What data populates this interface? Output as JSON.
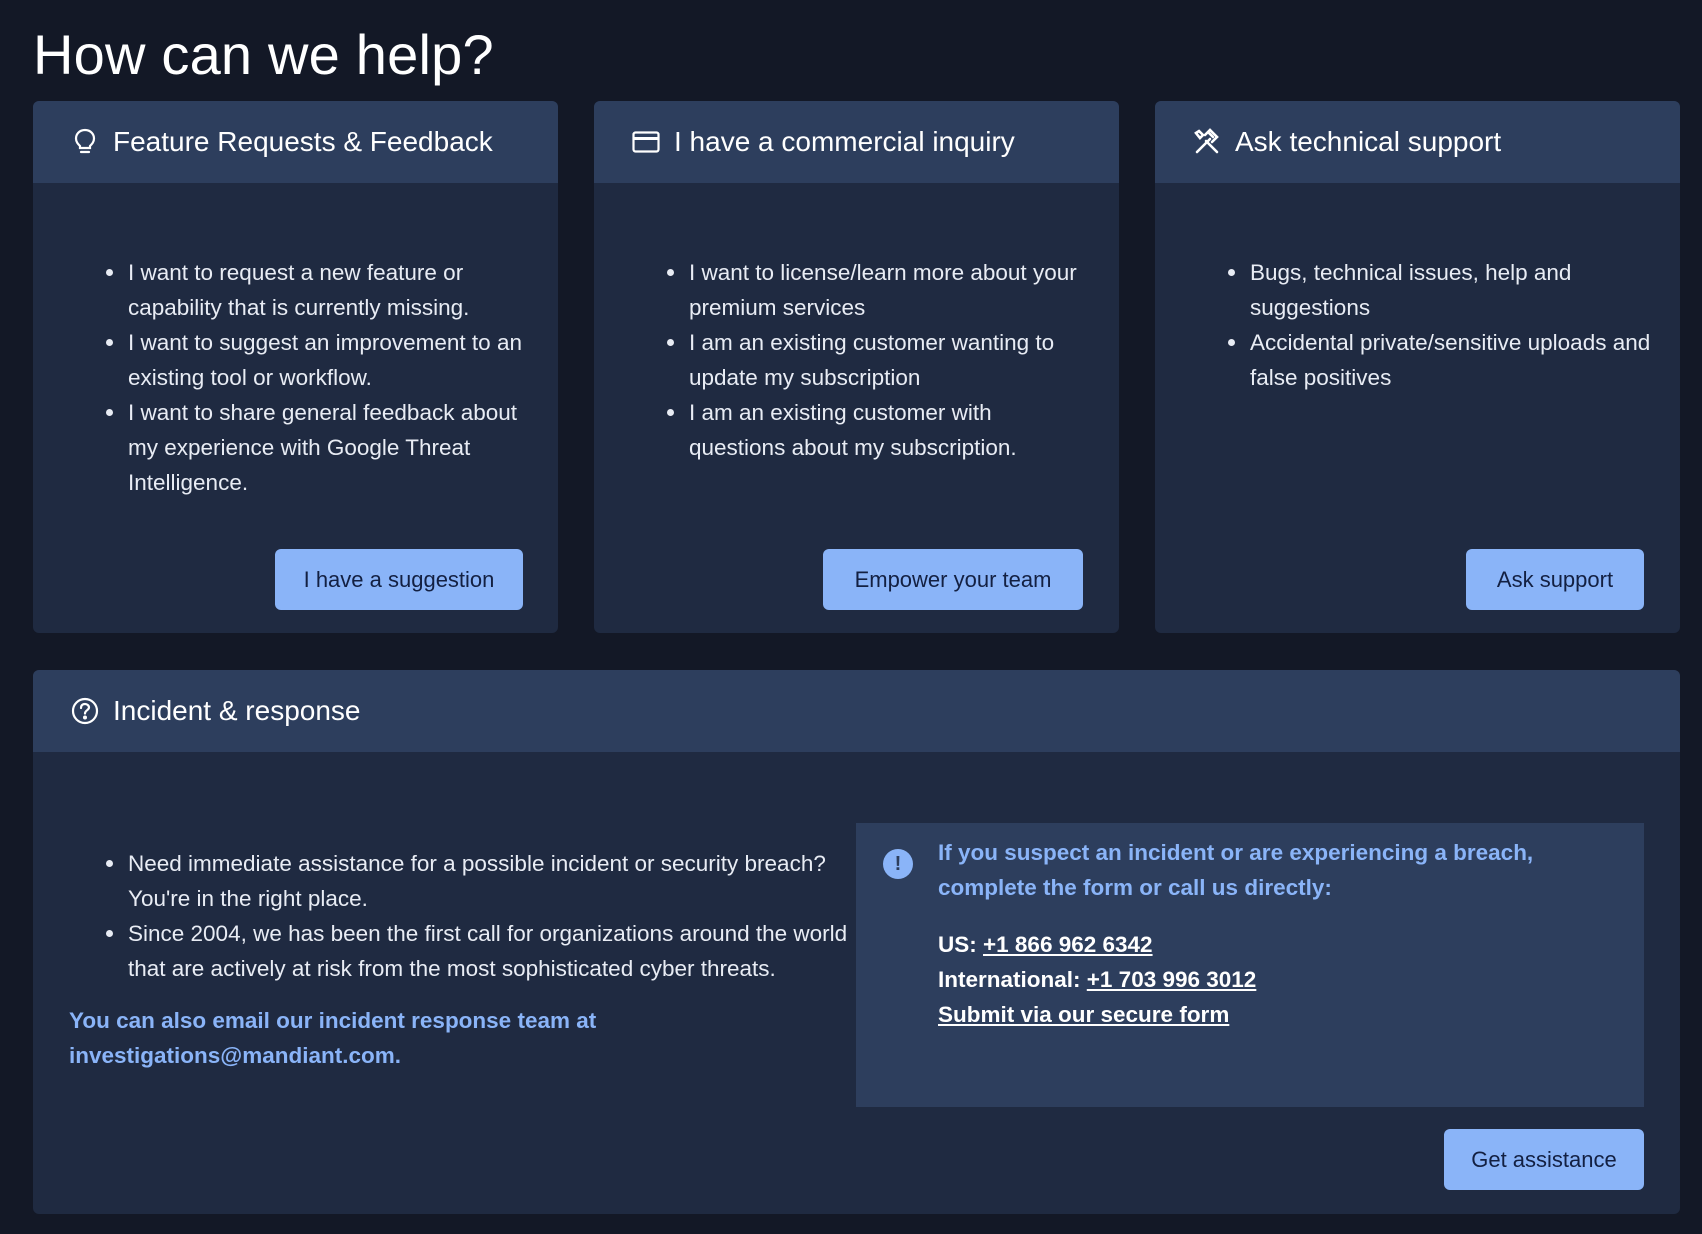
{
  "page": {
    "title": "How can we help?"
  },
  "cards": [
    {
      "title": "Feature Requests & Feedback",
      "icon": "lightbulb-icon",
      "bullets": [
        "I want to request a new feature or capability that is currently missing.",
        "I want to suggest an improvement to an existing tool or workflow.",
        "I want to share general feedback about my experience with Google Threat Intelligence."
      ],
      "button": "I have a suggestion"
    },
    {
      "title": "I have a commercial inquiry",
      "icon": "credit-card-icon",
      "bullets": [
        "I want to license/learn more about your premium services",
        "I am an existing customer wanting to update my subscription",
        "I am an existing customer with questions about my subscription."
      ],
      "button": "Empower your team"
    },
    {
      "title": "Ask technical support",
      "icon": "tools-icon",
      "bullets": [
        "Bugs, technical issues, help and suggestions",
        "Accidental private/sensitive uploads and false positives"
      ],
      "button": "Ask support"
    }
  ],
  "incident": {
    "title": "Incident & response",
    "icon": "help-circle-icon",
    "bullets": [
      "Need immediate assistance for a possible incident or security breach? You're in the right place.",
      "Since 2004, we has been the first call for organizations around the world that are actively at risk from the most sophisticated cyber threats."
    ],
    "email_note": "You can also email our incident response team at investigations@mandiant.com.",
    "alert": {
      "icon": "alert-info-icon",
      "text": "If you suspect an incident or are experiencing a breach, complete the form or call us directly:",
      "us_label": "US:",
      "us_phone": "+1 866 962 6342",
      "intl_label": "International:",
      "intl_phone": "+1 703 996 3012",
      "form_link": "Submit via our secure form"
    },
    "button": "Get assistance"
  },
  "colors": {
    "background": "#131826",
    "card": "#1f2a41",
    "card_header": "#2d3e5d",
    "accent": "#8ab4f8"
  }
}
